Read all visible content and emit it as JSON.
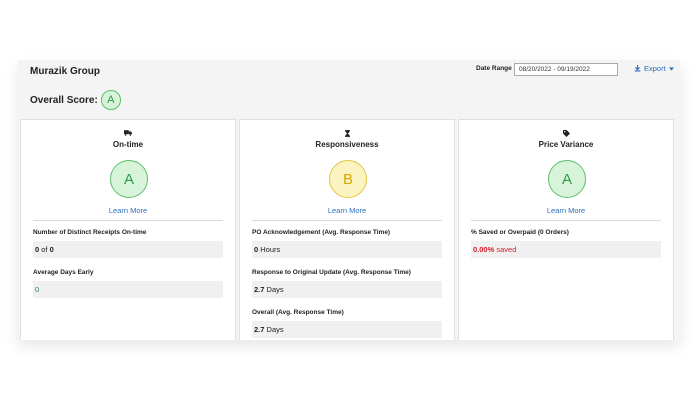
{
  "header": {
    "org_name": "Murazik Group",
    "date_range_label": "Date Range",
    "date_range_value": "08/20/2022 - 09/19/2022",
    "export_label": "Export"
  },
  "overall": {
    "label": "Overall Score:",
    "grade": "A"
  },
  "cards": [
    {
      "icon": "truck-icon",
      "title": "On-time",
      "grade": "A",
      "grade_color": "#2e9b45",
      "learn_more": "Learn More",
      "metrics": [
        {
          "label": "Number of Distinct Receipts On-time",
          "value_a": "0",
          "value_mid": " of ",
          "value_b": "0"
        },
        {
          "label": "Average Days Early",
          "value": "0"
        }
      ]
    },
    {
      "icon": "hourglass-icon",
      "title": "Responsiveness",
      "grade": "B",
      "grade_color": "#d8a800",
      "learn_more": "Learn More",
      "metrics": [
        {
          "label": "PO Acknowledgement (Avg. Response Time)",
          "value_num": "0",
          "value_unit": " Hours"
        },
        {
          "label": "Response to Original Update (Avg. Response Time)",
          "value_num": "2.7",
          "value_unit": " Days"
        },
        {
          "label": "Overall (Avg. Response Time)",
          "value_num": "2.7",
          "value_unit": " Days"
        }
      ]
    },
    {
      "icon": "tag-icon",
      "title": "Price Variance",
      "grade": "A",
      "grade_color": "#2e9b45",
      "learn_more": "Learn More",
      "metrics": [
        {
          "label": "% Saved or Overpaid (0 Orders)",
          "value_num": "0.00%",
          "value_unit": " saved",
          "value_color": "#d61f2c"
        }
      ]
    }
  ]
}
